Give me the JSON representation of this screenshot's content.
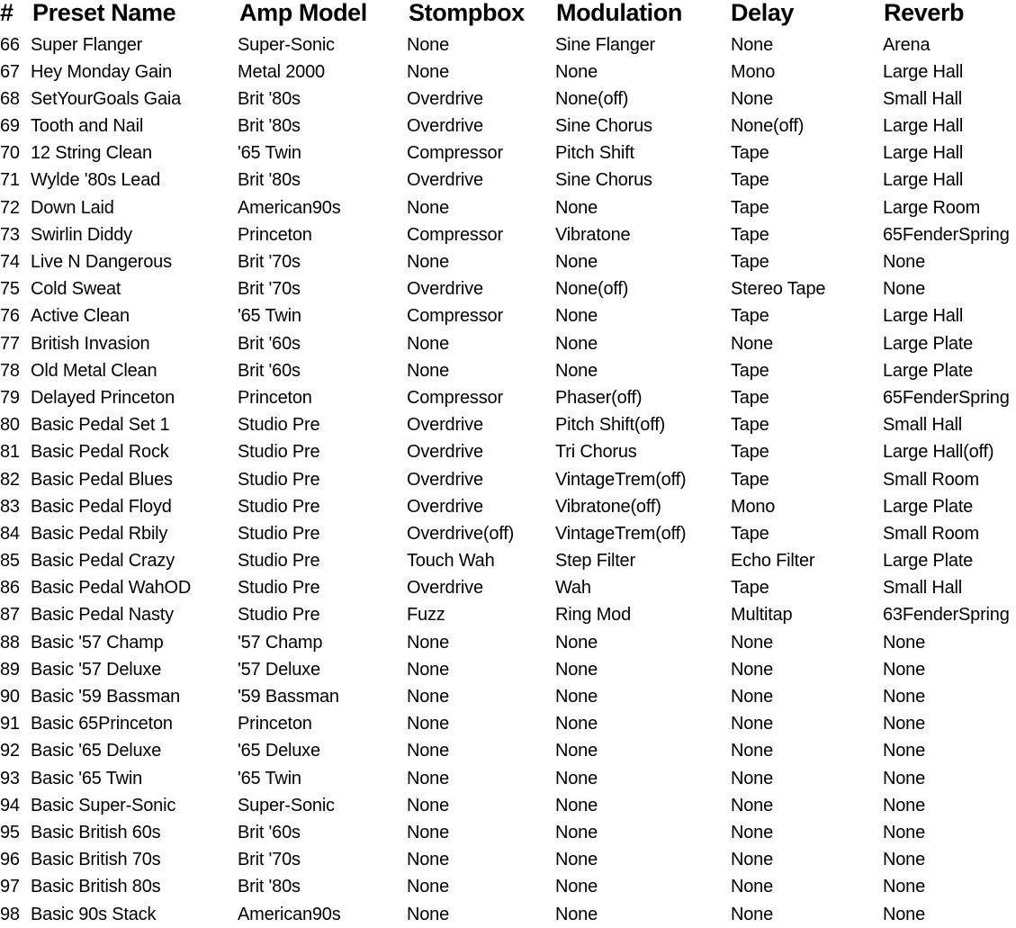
{
  "table": {
    "headers": {
      "num": "#",
      "name": "Preset Name",
      "amp": "Amp Model",
      "stomp": "Stompbox",
      "mod": "Modulation",
      "delay": "Delay",
      "reverb": "Reverb"
    },
    "rows": [
      {
        "num": "66",
        "name": "Super Flanger",
        "amp": "Super-Sonic",
        "stomp": "None",
        "mod": "Sine Flanger",
        "delay": "None",
        "reverb": "Arena"
      },
      {
        "num": "67",
        "name": "Hey Monday Gain",
        "amp": "Metal 2000",
        "stomp": "None",
        "mod": "None",
        "delay": "Mono",
        "reverb": "Large Hall"
      },
      {
        "num": "68",
        "name": "SetYourGoals Gaia",
        "amp": "Brit '80s",
        "stomp": "Overdrive",
        "mod": "None(off)",
        "delay": "None",
        "reverb": "Small Hall"
      },
      {
        "num": "69",
        "name": "Tooth and Nail",
        "amp": "Brit '80s",
        "stomp": "Overdrive",
        "mod": "Sine Chorus",
        "delay": "None(off)",
        "reverb": "Large Hall"
      },
      {
        "num": "70",
        "name": "12 String Clean",
        "amp": "'65 Twin",
        "stomp": "Compressor",
        "mod": "Pitch Shift",
        "delay": "Tape",
        "reverb": "Large Hall"
      },
      {
        "num": "71",
        "name": "Wylde '80s Lead",
        "amp": "Brit '80s",
        "stomp": "Overdrive",
        "mod": "Sine Chorus",
        "delay": "Tape",
        "reverb": "Large Hall"
      },
      {
        "num": "72",
        "name": "Down Laid",
        "amp": "American90s",
        "stomp": "None",
        "mod": "None",
        "delay": "Tape",
        "reverb": "Large Room"
      },
      {
        "num": "73",
        "name": "Swirlin Diddy",
        "amp": "Princeton",
        "stomp": "Compressor",
        "mod": "Vibratone",
        "delay": "Tape",
        "reverb": "65FenderSpring"
      },
      {
        "num": "74",
        "name": "Live N Dangerous",
        "amp": "Brit '70s",
        "stomp": "None",
        "mod": "None",
        "delay": "Tape",
        "reverb": "None"
      },
      {
        "num": "75",
        "name": "Cold Sweat",
        "amp": "Brit '70s",
        "stomp": "Overdrive",
        "mod": "None(off)",
        "delay": "Stereo Tape",
        "reverb": "None"
      },
      {
        "num": "76",
        "name": "Active Clean",
        "amp": "'65 Twin",
        "stomp": "Compressor",
        "mod": "None",
        "delay": "Tape",
        "reverb": "Large Hall"
      },
      {
        "num": "77",
        "name": "British Invasion",
        "amp": "Brit '60s",
        "stomp": "None",
        "mod": "None",
        "delay": "None",
        "reverb": "Large Plate"
      },
      {
        "num": "78",
        "name": "Old Metal Clean",
        "amp": "Brit '60s",
        "stomp": "None",
        "mod": "None",
        "delay": "Tape",
        "reverb": "Large Plate"
      },
      {
        "num": "79",
        "name": "Delayed Princeton",
        "amp": "Princeton",
        "stomp": "Compressor",
        "mod": "Phaser(off)",
        "delay": "Tape",
        "reverb": "65FenderSpring"
      },
      {
        "num": "80",
        "name": "Basic Pedal Set 1",
        "amp": "Studio Pre",
        "stomp": "Overdrive",
        "mod": "Pitch Shift(off)",
        "delay": "Tape",
        "reverb": "Small Hall"
      },
      {
        "num": "81",
        "name": "Basic Pedal Rock",
        "amp": "Studio Pre",
        "stomp": "Overdrive",
        "mod": "Tri Chorus",
        "delay": "Tape",
        "reverb": "Large Hall(off)"
      },
      {
        "num": "82",
        "name": "Basic Pedal Blues",
        "amp": "Studio Pre",
        "stomp": "Overdrive",
        "mod": "VintageTrem(off)",
        "delay": "Tape",
        "reverb": "Small Room"
      },
      {
        "num": "83",
        "name": "Basic Pedal Floyd",
        "amp": "Studio Pre",
        "stomp": "Overdrive",
        "mod": "Vibratone(off)",
        "delay": "Mono",
        "reverb": "Large Plate"
      },
      {
        "num": "84",
        "name": "Basic Pedal Rbily",
        "amp": "Studio Pre",
        "stomp": "Overdrive(off)",
        "mod": "VintageTrem(off)",
        "delay": "Tape",
        "reverb": "Small Room"
      },
      {
        "num": "85",
        "name": "Basic Pedal Crazy",
        "amp": "Studio Pre",
        "stomp": "Touch Wah",
        "mod": "Step Filter",
        "delay": "Echo Filter",
        "reverb": "Large Plate"
      },
      {
        "num": "86",
        "name": "Basic Pedal WahOD",
        "amp": "Studio Pre",
        "stomp": "Overdrive",
        "mod": "Wah",
        "delay": "Tape",
        "reverb": "Small Hall"
      },
      {
        "num": "87",
        "name": "Basic Pedal Nasty",
        "amp": "Studio Pre",
        "stomp": "Fuzz",
        "mod": "Ring Mod",
        "delay": "Multitap",
        "reverb": "63FenderSpring"
      },
      {
        "num": "88",
        "name": "Basic '57 Champ",
        "amp": "'57 Champ",
        "stomp": "None",
        "mod": "None",
        "delay": "None",
        "reverb": "None"
      },
      {
        "num": "89",
        "name": "Basic '57 Deluxe",
        "amp": "'57 Deluxe",
        "stomp": "None",
        "mod": "None",
        "delay": "None",
        "reverb": "None"
      },
      {
        "num": "90",
        "name": "Basic '59 Bassman",
        "amp": "'59 Bassman",
        "stomp": "None",
        "mod": "None",
        "delay": "None",
        "reverb": "None"
      },
      {
        "num": "91",
        "name": "Basic 65Princeton",
        "amp": "Princeton",
        "stomp": "None",
        "mod": "None",
        "delay": "None",
        "reverb": "None"
      },
      {
        "num": "92",
        "name": "Basic '65 Deluxe",
        "amp": "'65 Deluxe",
        "stomp": "None",
        "mod": "None",
        "delay": "None",
        "reverb": "None"
      },
      {
        "num": "93",
        "name": "Basic '65 Twin",
        "amp": "'65 Twin",
        "stomp": "None",
        "mod": "None",
        "delay": "None",
        "reverb": "None"
      },
      {
        "num": "94",
        "name": "Basic Super-Sonic",
        "amp": "Super-Sonic",
        "stomp": "None",
        "mod": "None",
        "delay": "None",
        "reverb": "None"
      },
      {
        "num": "95",
        "name": "Basic British 60s",
        "amp": "Brit '60s",
        "stomp": "None",
        "mod": "None",
        "delay": "None",
        "reverb": "None"
      },
      {
        "num": "96",
        "name": "Basic British 70s",
        "amp": "Brit '70s",
        "stomp": "None",
        "mod": "None",
        "delay": "None",
        "reverb": "None"
      },
      {
        "num": "97",
        "name": "Basic British 80s",
        "amp": "Brit '80s",
        "stomp": "None",
        "mod": "None",
        "delay": "None",
        "reverb": "None"
      },
      {
        "num": "98",
        "name": "Basic 90s Stack",
        "amp": "American90s",
        "stomp": "None",
        "mod": "None",
        "delay": "None",
        "reverb": "None"
      }
    ]
  }
}
